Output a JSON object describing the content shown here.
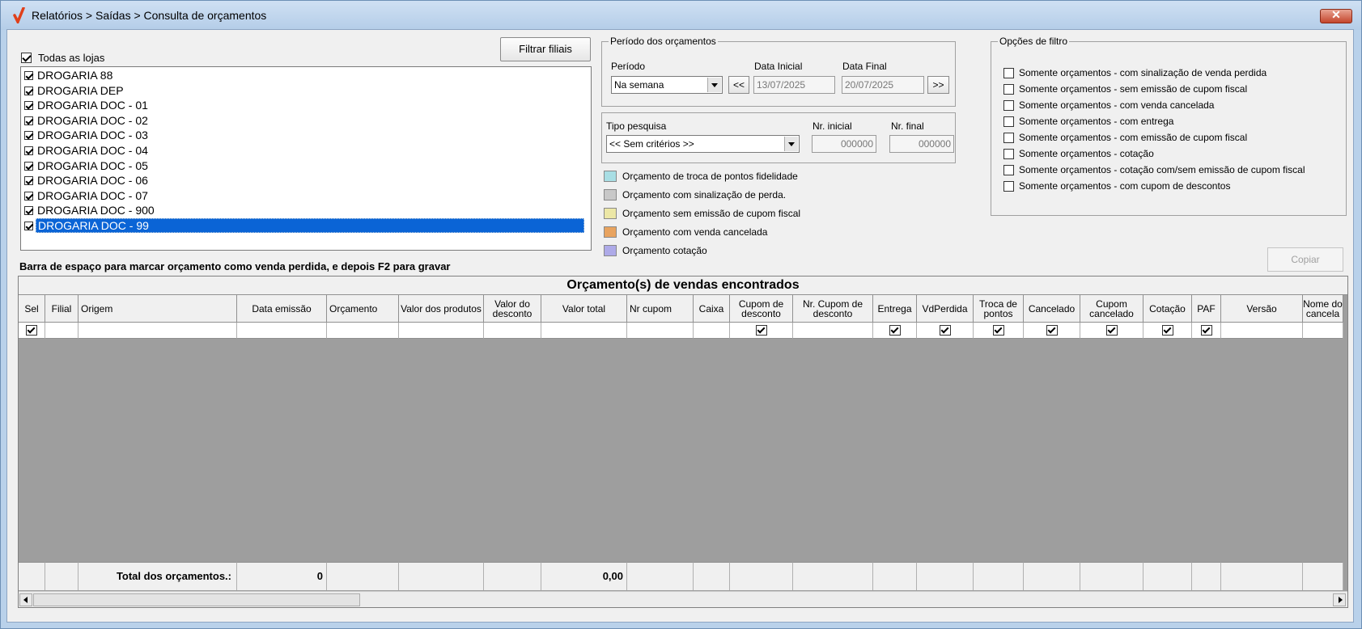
{
  "window": {
    "title": "Relatórios > Saídas > Consulta de orçamentos"
  },
  "stores": {
    "all_label": "Todas as lojas",
    "all_checked": true,
    "filter_button": "Filtrar filiais",
    "items": [
      {
        "label": "DROGARIA 88",
        "checked": true
      },
      {
        "label": "DROGARIA DEP",
        "checked": true
      },
      {
        "label": "DROGARIA DOC - 01",
        "checked": true
      },
      {
        "label": "DROGARIA DOC - 02",
        "checked": true
      },
      {
        "label": "DROGARIA DOC - 03",
        "checked": true
      },
      {
        "label": "DROGARIA DOC - 04",
        "checked": true
      },
      {
        "label": "DROGARIA DOC - 05",
        "checked": true
      },
      {
        "label": "DROGARIA DOC - 06",
        "checked": true
      },
      {
        "label": "DROGARIA DOC - 07",
        "checked": true
      },
      {
        "label": "DROGARIA DOC - 900",
        "checked": true
      },
      {
        "label": "DROGARIA DOC - 99",
        "checked": true,
        "selected": true
      }
    ]
  },
  "period": {
    "group_title": "Período dos orçamentos",
    "period_label": "Período",
    "period_value": "Na semana",
    "start_label": "Data Inicial",
    "start_value": "13/07/2025",
    "end_label": "Data Final",
    "end_value": "20/07/2025",
    "prev_button": "<<",
    "next_button": ">>"
  },
  "search": {
    "type_label": "Tipo pesquisa",
    "type_value": "<< Sem critérios >>",
    "nr_initial_label": "Nr. inicial",
    "nr_initial_value": "000000",
    "nr_final_label": "Nr. final",
    "nr_final_value": "000000"
  },
  "legend": [
    {
      "label": "Orçamento de troca de pontos fidelidade",
      "color": "#a8dee4"
    },
    {
      "label": "Orçamento com sinalização de perda.",
      "color": "#c8c8c8"
    },
    {
      "label": "Orçamento sem emissão de cupom fiscal",
      "color": "#ece7a6"
    },
    {
      "label": "Orçamento com venda cancelada",
      "color": "#e8a35f"
    },
    {
      "label": "Orçamento cotação",
      "color": "#aeaae8"
    }
  ],
  "filter_options": {
    "group_title": "Opções de filtro",
    "items": [
      {
        "label": "Somente orçamentos - com sinalização de venda perdida",
        "checked": false
      },
      {
        "label": "Somente orçamentos - sem emissão de cupom fiscal",
        "checked": false
      },
      {
        "label": "Somente orçamentos - com venda cancelada",
        "checked": false
      },
      {
        "label": "Somente orçamentos - com entrega",
        "checked": false
      },
      {
        "label": "Somente orçamentos - com emissão de cupom fiscal",
        "checked": false
      },
      {
        "label": "Somente orçamentos - cotação",
        "checked": false
      },
      {
        "label": "Somente orçamentos - cotação com/sem emissão de cupom fiscal",
        "checked": false
      },
      {
        "label": "Somente orçamentos - com cupom de descontos",
        "checked": false
      }
    ]
  },
  "hint": "Barra de espaço para marcar orçamento como venda perdida, e depois F2 para gravar",
  "copy_button": "Copiar",
  "grid": {
    "caption": "Orçamento(s) de vendas encontrados",
    "columns": [
      {
        "label": "Sel",
        "checkbox": true
      },
      {
        "label": "Filial",
        "checkbox": false
      },
      {
        "label": "Origem",
        "checkbox": false
      },
      {
        "label": "Data emissão",
        "checkbox": false
      },
      {
        "label": "Orçamento",
        "checkbox": false
      },
      {
        "label": "Valor dos produtos",
        "checkbox": false
      },
      {
        "label": "Valor do desconto",
        "checkbox": false
      },
      {
        "label": "Valor total",
        "checkbox": false
      },
      {
        "label": "Nr cupom",
        "checkbox": false
      },
      {
        "label": "Caixa",
        "checkbox": false
      },
      {
        "label": "Cupom de desconto",
        "checkbox": true
      },
      {
        "label": "Nr. Cupom de desconto",
        "checkbox": false
      },
      {
        "label": "Entrega",
        "checkbox": true
      },
      {
        "label": "VdPerdida",
        "checkbox": true
      },
      {
        "label": "Troca de pontos",
        "checkbox": true
      },
      {
        "label": "Cancelado",
        "checkbox": true
      },
      {
        "label": "Cupom cancelado",
        "checkbox": true
      },
      {
        "label": "Cotação",
        "checkbox": true
      },
      {
        "label": "PAF",
        "checkbox": true
      },
      {
        "label": "Versão",
        "checkbox": false
      },
      {
        "label": "Nome do cancela",
        "checkbox": false
      }
    ],
    "total_label": "Total dos orçamentos.:",
    "total_count": "0",
    "total_value": "0,00"
  }
}
